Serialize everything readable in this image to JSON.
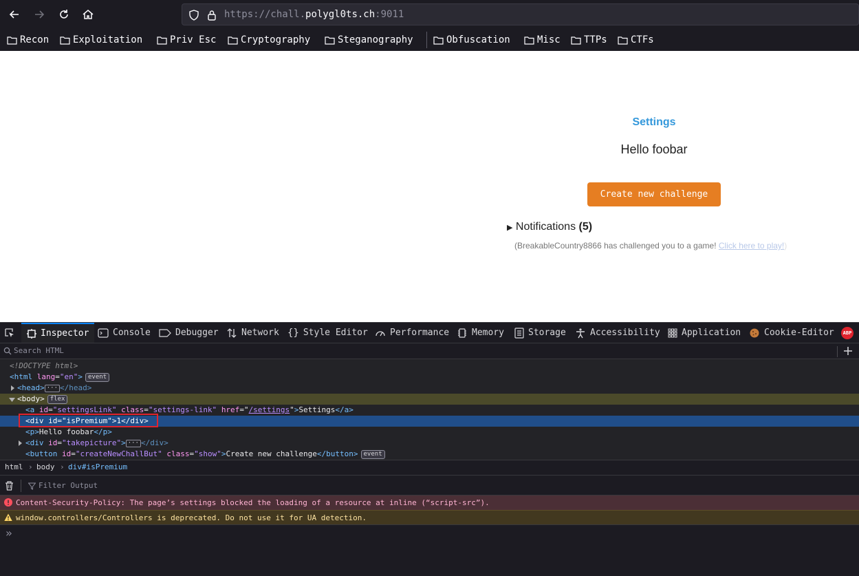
{
  "browser": {
    "url_prefix": "https://chall.",
    "url_domain": "polygl0ts.ch",
    "url_suffix": ":9011"
  },
  "bookmarks": [
    "Recon",
    "Exploitation",
    "Priv Esc",
    "Cryptography",
    "Steganography",
    "Obfuscation",
    "Misc",
    "TTPs",
    "CTFs"
  ],
  "page": {
    "settings_link": "Settings",
    "greeting": "Hello foobar",
    "create_button": "Create new challenge",
    "notifications_label": "Notifications",
    "notifications_count": "(5)",
    "notification_text": "(BreakableCountry8866 has challenged you to a game!",
    "notification_link": "Click here to play!",
    "notification_tail": ")"
  },
  "devtools": {
    "tabs": [
      "Inspector",
      "Console",
      "Debugger",
      "Network",
      "Style Editor",
      "Performance",
      "Memory",
      "Storage",
      "Accessibility",
      "Application",
      "Cookie-Editor"
    ],
    "abp_label": "ABP",
    "search_placeholder": "Search HTML",
    "tree": {
      "doctype": "<!DOCTYPE html>",
      "html_open": "<html",
      "html_attr": "lang",
      "html_val": "\"en\"",
      "html_close": ">",
      "event_badge": "event",
      "head_open": "<head>",
      "head_close": "</head>",
      "body_open": "<body>",
      "flex_badge": "flex",
      "a_tag": "<a",
      "a_id_attr": "id",
      "a_id_val": "\"settingsLink\"",
      "a_class_attr": "class",
      "a_class_val": "\"settings-link\"",
      "a_href_attr": "href",
      "a_href_val": "/settings",
      "a_text": "Settings",
      "a_close": "</a>",
      "div_premium": "<div id=\"isPremium\">1</div>",
      "p_open": "<p>",
      "p_text": "Hello foobar",
      "p_close": "</p>",
      "div_take_open": "<div",
      "div_take_attr": "id",
      "div_take_val": "\"takepicture\"",
      "div_close": "</div>",
      "button_open": "<button",
      "button_id_attr": "id",
      "button_id_val": "\"createNewChallBut\"",
      "button_class_attr": "class",
      "button_class_val": "\"show\"",
      "button_text": "Create new challenge",
      "button_close": "</button>"
    },
    "breadcrumbs": [
      "html",
      "body",
      "div#isPremium"
    ],
    "console_filter_placeholder": "Filter Output",
    "messages": {
      "error": "Content-Security-Policy: The page’s settings blocked the loading of a resource at inline (“script-src”).",
      "warning": "window.controllers/Controllers is deprecated. Do not use it for UA detection."
    },
    "prompt": "»"
  }
}
